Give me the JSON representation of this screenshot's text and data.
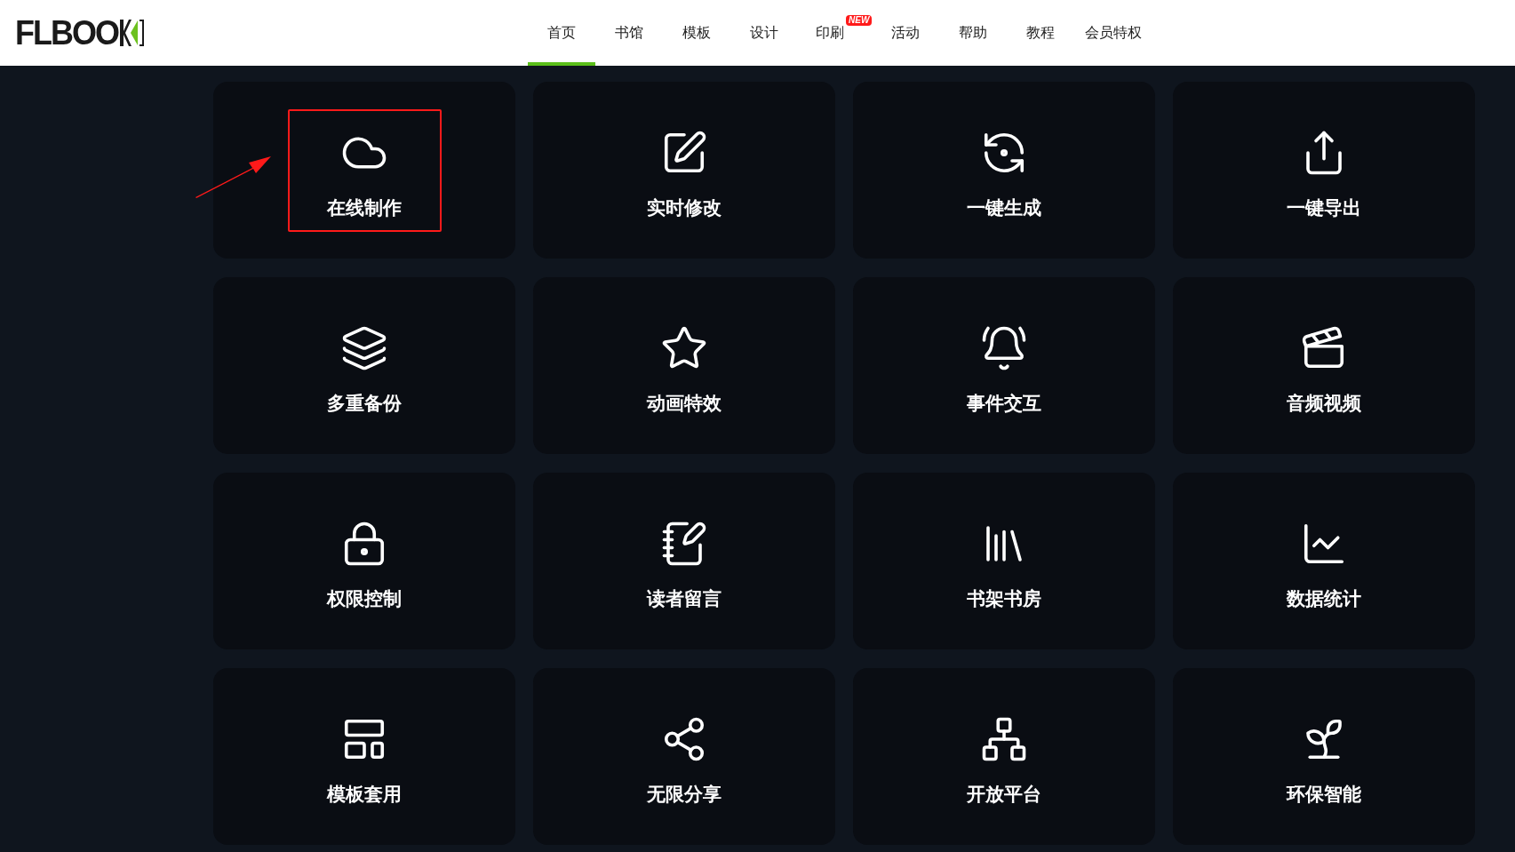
{
  "header": {
    "logo": "FLBOO",
    "nav": [
      {
        "label": "首页",
        "selected": true
      },
      {
        "label": "书馆",
        "selected": false
      },
      {
        "label": "模板",
        "selected": false
      },
      {
        "label": "设计",
        "selected": false
      },
      {
        "label": "印刷",
        "selected": false,
        "badge": "NEW"
      },
      {
        "label": "活动",
        "selected": false
      },
      {
        "label": "帮助",
        "selected": false
      },
      {
        "label": "教程",
        "selected": false
      },
      {
        "label": "会员特权",
        "selected": false
      }
    ]
  },
  "features": [
    {
      "label": "在线制作",
      "highlighted": true
    },
    {
      "label": "实时修改",
      "highlighted": false
    },
    {
      "label": "一键生成",
      "highlighted": false
    },
    {
      "label": "一键导出",
      "highlighted": false
    },
    {
      "label": "多重备份",
      "highlighted": false
    },
    {
      "label": "动画特效",
      "highlighted": false
    },
    {
      "label": "事件交互",
      "highlighted": false
    },
    {
      "label": "音频视频",
      "highlighted": false
    },
    {
      "label": "权限控制",
      "highlighted": false
    },
    {
      "label": "读者留言",
      "highlighted": false
    },
    {
      "label": "书架书房",
      "highlighted": false
    },
    {
      "label": "数据统计",
      "highlighted": false
    },
    {
      "label": "模板套用",
      "highlighted": false
    },
    {
      "label": "无限分享",
      "highlighted": false
    },
    {
      "label": "开放平台",
      "highlighted": false
    },
    {
      "label": "环保智能",
      "highlighted": false
    }
  ]
}
